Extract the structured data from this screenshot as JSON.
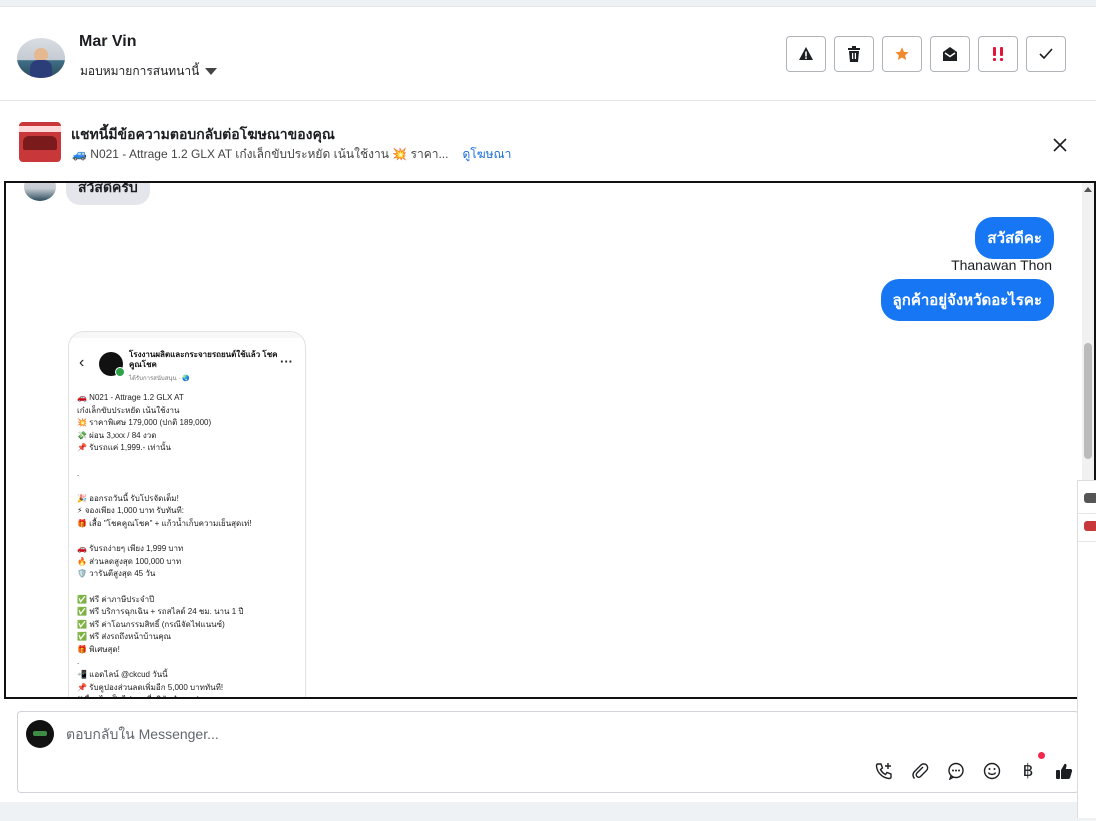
{
  "header": {
    "name": "Mar Vin",
    "assign_label": "มอบหมายการสนทนานี้",
    "actions": [
      {
        "name": "report-spam-button",
        "icon": "warning-icon"
      },
      {
        "name": "delete-button",
        "icon": "trash-icon"
      },
      {
        "name": "star-button",
        "icon": "star-icon"
      },
      {
        "name": "mark-unread-button",
        "icon": "envelope-open-icon"
      },
      {
        "name": "mark-urgent-button",
        "icon": "urgent-icon"
      },
      {
        "name": "mark-done-button",
        "icon": "check-icon"
      }
    ]
  },
  "ad_banner": {
    "title": "แชทนี้มีข้อความตอบกลับต่อโฆษณาของคุณ",
    "snippet": "🚙 N021 - Attrage 1.2 GLX AT เก๋งเล็กขับประหยัด เน้นใช้งาน 💥 ราคา...",
    "link": "ดูโฆษณา"
  },
  "messages": {
    "incoming_top": "สวัสดีครับ",
    "outgoing_1": "สวัสดีคะ",
    "sender": "Thanawan Thon",
    "outgoing_2": "ลูกค้าอยู่จังหวัดอะไรคะ"
  },
  "image_post": {
    "page_name": "โรงงานผลิตและกระจายรถยนต์ใช้แล้ว โชคคูณโชค",
    "page_sub": "ได้รับการสนับสนุน · 🌏",
    "body": "🚗 N021 - Attrage 1.2 GLX AT\nเก๋งเล็กขับประหยัด เน้นใช้งาน\n💥 ราคาพิเศษ 179,000 (ปกติ 189,000)\n💸 ผ่อน 3,xxx / 84 งวด\n📌 รับรถแค่ 1,999.- เท่านั้น\n\n.\n\n🎉 ออกรถวันนี้ รับโปรจัดเต็ม!\n⚡ จองเพียง 1,000 บาท รับทันที:\n🎁 เสื้อ \"โชคคูณโชค\" + แก้วน้ำเก็บความเย็นสุดเท่!\n\n🚗 รับรถง่ายๆ เพียง 1,999 บาท\n🔥 ส่วนลดสูงสุด 100,000 บาท\n🛡️ วารันตีสูงสุด 45 วัน\n\n✅ ฟรี ค่าภาษีประจำปี\n✅ ฟรี บริการฉุกเฉิน + รถสไลด์ 24 ชม. นาน 1 ปี\n✅ ฟรี ค่าโอนกรรมสิทธิ์ (กรณีจัดไฟแนนซ์)\n✅ ฟรี ส่งรถถึงหน้าบ้านคุณ\n🎁 พิเศษสุด!\n.\n📲 แอดไลน์ @ckcud วันนี้\n📌 รับคูปองส่วนลดเพิ่มอีก 5,000 บาททันที!\n(*เงื่อนไขเป็นไปตามที่บริษัทกำหนด)"
  },
  "composer": {
    "placeholder": "ตอบกลับใน Messenger...",
    "tools": [
      "phone-plus-icon",
      "attachment-icon",
      "saved-reply-icon",
      "emoji-icon",
      "baht-payment-icon",
      "thumbs-up-icon"
    ]
  }
}
